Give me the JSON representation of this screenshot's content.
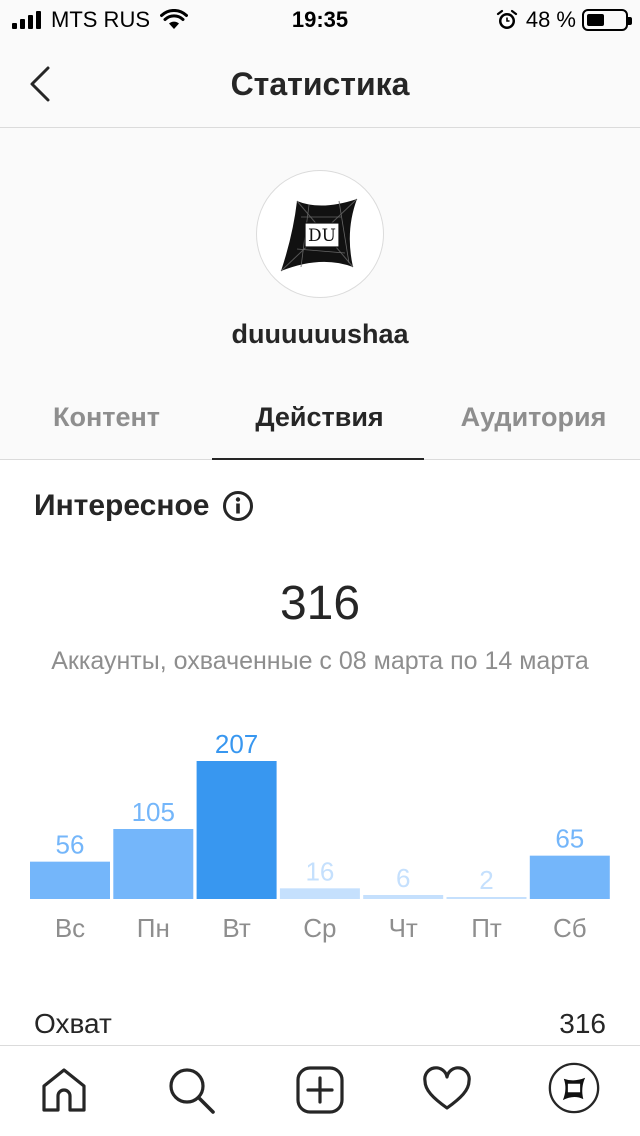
{
  "status_bar": {
    "carrier": "MTS RUS",
    "time": "19:35",
    "battery_text": "48 %",
    "battery_level": 0.48
  },
  "header": {
    "title": "Статистика",
    "back_icon": "chevron-left-icon"
  },
  "profile": {
    "username": "duuuuuushaa",
    "avatar_text": "DU"
  },
  "tabs": [
    {
      "label": "Контент",
      "active": false
    },
    {
      "label": "Действия",
      "active": true
    },
    {
      "label": "Аудитория",
      "active": false
    }
  ],
  "section": {
    "title": "Интересное",
    "total": "316",
    "subtitle": "Аккаунты, охваченные с 08 марта по 14 марта"
  },
  "chart_data": {
    "type": "bar",
    "categories": [
      "Вс",
      "Пн",
      "Вт",
      "Ср",
      "Чт",
      "Пт",
      "Сб"
    ],
    "values": [
      56,
      105,
      207,
      16,
      6,
      2,
      65
    ],
    "max_color": "#3897f0",
    "mid_color": "#74b6fa",
    "low_color": "#c5e0fd"
  },
  "reach": {
    "label": "Охват",
    "value": "316"
  },
  "tabbar": {
    "items": [
      "home-icon",
      "search-icon",
      "new-post-icon",
      "heart-icon",
      "profile-avatar-icon"
    ]
  },
  "colors": {
    "text_primary": "#262626",
    "text_secondary": "#8e8e8e",
    "divider": "#dbdbdb",
    "accent": "#3897f0"
  }
}
